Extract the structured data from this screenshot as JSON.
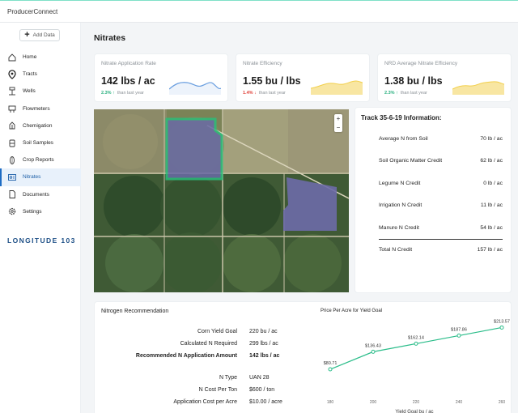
{
  "app": {
    "title": "ProducerConnect"
  },
  "sidebar": {
    "add_label": "Add Data",
    "items": [
      {
        "label": "Home",
        "icon": "home-icon"
      },
      {
        "label": "Tracts",
        "icon": "location-pin-icon"
      },
      {
        "label": "Wells",
        "icon": "well-icon"
      },
      {
        "label": "Flowmeters",
        "icon": "flowmeter-icon"
      },
      {
        "label": "Chemigation",
        "icon": "chemigation-icon"
      },
      {
        "label": "Soil Samples",
        "icon": "soil-sample-icon"
      },
      {
        "label": "Crop Reports",
        "icon": "crop-icon"
      },
      {
        "label": "Nitrates",
        "icon": "nitrates-icon",
        "active": true
      },
      {
        "label": "Documents",
        "icon": "document-icon"
      },
      {
        "label": "Settings",
        "icon": "gear-icon"
      }
    ],
    "logo": "LONGITUDE 103"
  },
  "page": {
    "title": "Nitrates"
  },
  "kpis": [
    {
      "label": "Nitrate Application Rate",
      "value": "142 lbs / ac",
      "change": "2.3%",
      "direction": "up",
      "since": "than last year",
      "spark_color": "#6a9fe0"
    },
    {
      "label": "Nitrate Efficiency",
      "value": "1.55 bu / lbs",
      "change": "1.4%",
      "direction": "down",
      "since": "than last year",
      "spark_color": "#f2cf4a"
    },
    {
      "label": "NRD Average Nitrate Efficiency",
      "value": "1.38 bu / lbs",
      "change": "2.3%",
      "direction": "up",
      "since": "than last year",
      "spark_color": "#f2cf4a"
    }
  ],
  "map": {
    "zoom_in": "+",
    "zoom_out": "−"
  },
  "info": {
    "title": "Track 35-6-19 Information:",
    "rows": [
      {
        "label": "Average N from Soil",
        "value": "70 lb / ac"
      },
      {
        "label": "Soil Organic Matter Credit",
        "value": "62 lb / ac"
      },
      {
        "label": "Legume N Credit",
        "value": "0 lb / ac"
      },
      {
        "label": "Irrigation N Credit",
        "value": "11 lb / ac"
      },
      {
        "label": "Manure N Credit",
        "value": "54 lb / ac"
      }
    ],
    "total": {
      "label": "Total N Credit",
      "value": "157 lb / ac"
    }
  },
  "recommendation": {
    "title": "Nitrogen Recommendation",
    "rows": [
      {
        "label": "Corn Yield Goal",
        "value": "220  bu / ac",
        "bold": false
      },
      {
        "label": "Calculated N Required",
        "value": "299 lbs / ac",
        "bold": false
      },
      {
        "label": "Recommended N Application Amount",
        "value": "142 lbs / ac",
        "bold": true
      },
      {
        "label": "N Type",
        "value": "UAN 28",
        "bold": false
      },
      {
        "label": "N Cost Per Ton",
        "value": "$600 / ton",
        "bold": false
      },
      {
        "label": "Application Cost per Acre",
        "value": "$10.00 / acre",
        "bold": false
      }
    ]
  },
  "chart_data": {
    "type": "line",
    "title": "Price Per Acre for Yield Goal",
    "xlabel": "Yield Goal bu / ac",
    "ylabel": "",
    "x": [
      180,
      200,
      220,
      240,
      260
    ],
    "series": [
      {
        "values": [
          80.71,
          136.43,
          162.14,
          187.86,
          213.57
        ]
      }
    ],
    "data_labels": [
      "$80.71",
      "$136.43",
      "$162.14",
      "$187.86",
      "$213.57"
    ],
    "color": "#2bbd8a",
    "grid": false,
    "xlim": [
      180,
      260
    ]
  }
}
